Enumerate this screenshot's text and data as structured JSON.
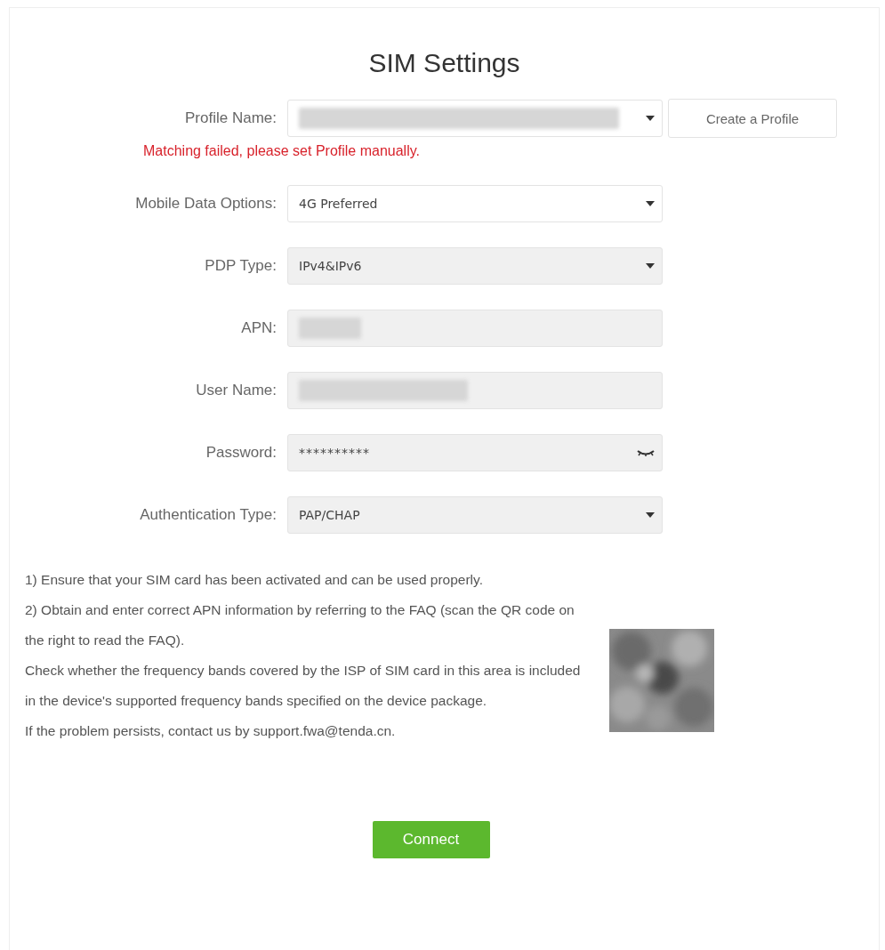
{
  "title": "SIM Settings",
  "fields": [
    {
      "label": "Profile Name:",
      "kind": "select",
      "value_redacted": true,
      "disabled": false,
      "button": "Create a Profile",
      "error": "Matching failed, please set Profile manually."
    },
    {
      "label": "Mobile Data Options:",
      "kind": "select",
      "value": "4G Preferred",
      "disabled": false
    },
    {
      "label": "PDP Type:",
      "kind": "select",
      "value": "IPv4&IPv6",
      "disabled": true
    },
    {
      "label": "APN:",
      "kind": "text",
      "value_redacted": true,
      "disabled": true
    },
    {
      "label": "User Name:",
      "kind": "text",
      "value_redacted": true,
      "disabled": true
    },
    {
      "label": "Password:",
      "kind": "password",
      "value": "**********",
      "disabled": true
    },
    {
      "label": "Authentication Type:",
      "kind": "select",
      "value": "PAP/CHAP",
      "disabled": true
    }
  ],
  "notes": [
    "1) Ensure that your SIM card has been activated and can be used properly.",
    "2) Obtain and enter correct APN information by referring to the FAQ (scan the QR code on the right to read the FAQ).",
    "Check whether the frequency bands covered by the ISP of SIM card in this area is included in the device's supported frequency bands specified on the device package.",
    "If the problem persists, contact us by support.fwa@tenda.cn."
  ],
  "connect_button": "Connect"
}
